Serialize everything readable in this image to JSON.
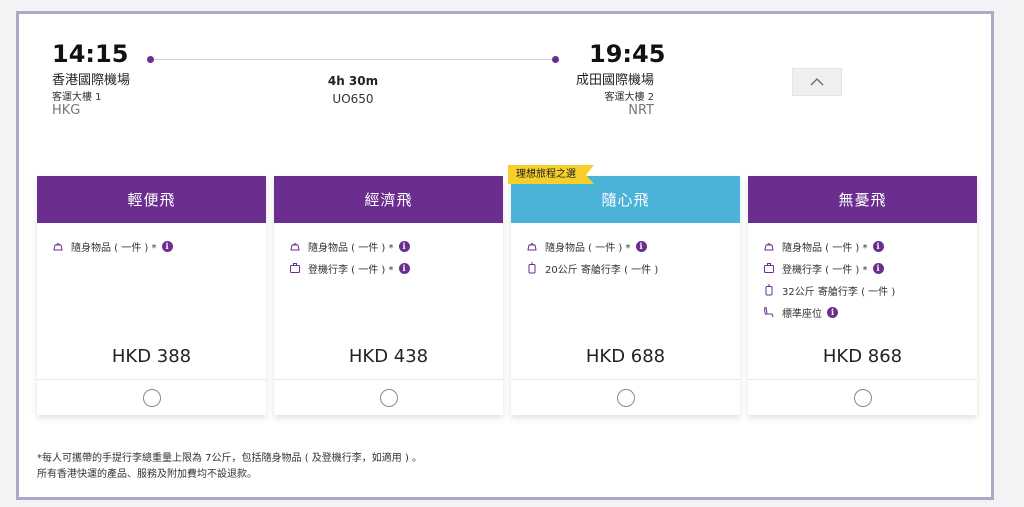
{
  "flight": {
    "departure": {
      "time": "14:15",
      "airport": "香港國際機場",
      "terminal": "客運大樓 1",
      "code": "HKG"
    },
    "arrival": {
      "time": "19:45",
      "airport": "成田國際機場",
      "terminal": "客運大樓 2",
      "code": "NRT"
    },
    "duration": "4h 30m",
    "flight_number": "UO650",
    "collapse_icon": "chevron-up-icon"
  },
  "recommend_badge": "理想旅程之選",
  "fares": [
    {
      "name": "輕便飛",
      "color": "#6b2e8f",
      "features": [
        {
          "icon": "carry-on-bag-icon",
          "text": "隨身物品 ( 一件 ) *",
          "info": true
        }
      ],
      "price": "HKD 388"
    },
    {
      "name": "經濟飛",
      "color": "#6b2e8f",
      "features": [
        {
          "icon": "carry-on-bag-icon",
          "text": "隨身物品 ( 一件 ) *",
          "info": true
        },
        {
          "icon": "cabin-bag-icon",
          "text": "登機行李 ( 一件 ) *",
          "info": true
        }
      ],
      "price": "HKD 438"
    },
    {
      "name": "隨心飛",
      "color": "#4cb3d8",
      "features": [
        {
          "icon": "carry-on-bag-icon",
          "text": "隨身物品 ( 一件 ) *",
          "info": true
        },
        {
          "icon": "checked-luggage-icon",
          "text": "20公斤 寄艙行李 ( 一件 )",
          "info": false
        }
      ],
      "price": "HKD 688"
    },
    {
      "name": "無憂飛",
      "color": "#6b2e8f",
      "features": [
        {
          "icon": "carry-on-bag-icon",
          "text": "隨身物品 ( 一件 ) *",
          "info": true
        },
        {
          "icon": "cabin-bag-icon",
          "text": "登機行李 ( 一件 ) *",
          "info": true
        },
        {
          "icon": "checked-luggage-icon",
          "text": "32公斤 寄艙行李 ( 一件 )",
          "info": false
        },
        {
          "icon": "seat-icon",
          "text": "標準座位",
          "info": true
        }
      ],
      "price": "HKD 868"
    }
  ],
  "info_glyph": "i",
  "footnote": {
    "line1": "*每人可攜帶的手提行李總重量上限為 7公斤，包括隨身物品 ( 及登機行李，如適用 ) 。",
    "line2": "所有香港快運的產品、服務及附加費均不設退款。"
  }
}
